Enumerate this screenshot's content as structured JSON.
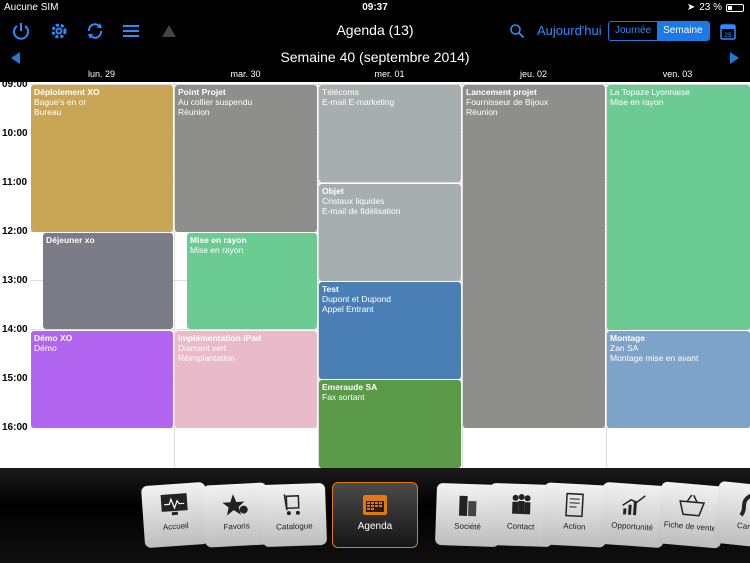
{
  "status": {
    "carrier": "Aucune SIM",
    "time": "09:37",
    "battery": "23 %"
  },
  "toolbar": {
    "title": "Agenda (13)",
    "today": "Aujourd'hui",
    "view_day": "Journée",
    "view_week": "Semaine",
    "calendar_day": "25"
  },
  "week": {
    "title": "Semaine 40 (septembre 2014)"
  },
  "days": [
    "lun. 29",
    "mar. 30",
    "mer. 01",
    "jeu. 02",
    "ven. 03"
  ],
  "hours": [
    "09:00",
    "10:00",
    "11:00",
    "12:00",
    "13:00",
    "14:00",
    "15:00",
    "16:00"
  ],
  "events": [
    {
      "title": "Déploiement XO",
      "lines": [
        "Bague's en or",
        "Bureau"
      ],
      "color": "#c8a655"
    },
    {
      "title": "Déjeuner xo",
      "lines": [],
      "color": "#7c7c86"
    },
    {
      "title": "Démo XO",
      "lines": [
        "Démo"
      ],
      "color": "#b265f0"
    },
    {
      "title": "Point Projet",
      "lines": [
        "Au collier suspendu",
        "Réunion"
      ],
      "color": "#8e8f8c"
    },
    {
      "title": "Mise en rayon",
      "lines": [
        "Mise en rayon"
      ],
      "color": "#6ccb92"
    },
    {
      "title": "Implémentation iPad",
      "lines": [
        "Diamant vert",
        "Réimplantation"
      ],
      "color": "#e9bac9"
    },
    {
      "title": "Télécoms",
      "lines": [
        "E-mail E-marketing"
      ],
      "color": "#a6aeaf",
      "title_bold": false
    },
    {
      "title": "Objet",
      "lines": [
        "Cristaux liquides",
        "E-mail de fidélisation"
      ],
      "color": "#a6aeaf"
    },
    {
      "title": "Test",
      "lines": [
        "Dupont et Dupond",
        "Appel Entrant"
      ],
      "color": "#4a7fb5"
    },
    {
      "title": "Emeraude SA",
      "lines": [
        "Fax sortant"
      ],
      "color": "#5a9a48"
    },
    {
      "title": "Lancement projet",
      "lines": [
        "Fournisseur de Bijoux",
        "Réunion"
      ],
      "color": "#8e8f8c"
    },
    {
      "title": "La Topaze Lyonnaise",
      "lines": [
        "Mise en rayon"
      ],
      "color": "#6ccb92",
      "title_bold": false
    },
    {
      "title": "Montage",
      "lines": [
        "Zan SA",
        "Montage mise en avant"
      ],
      "color": "#7ea3c8"
    }
  ],
  "dock": [
    {
      "label": "Accueil",
      "icon": "monitor-icon"
    },
    {
      "label": "Favoris",
      "icon": "star-icon"
    },
    {
      "label": "Catalogue",
      "icon": "cart-icon"
    },
    {
      "label": "Agenda",
      "icon": "calendar-icon",
      "active": true
    },
    {
      "label": "Société",
      "icon": "building-icon"
    },
    {
      "label": "Contact",
      "icon": "people-icon"
    },
    {
      "label": "Action",
      "icon": "document-icon"
    },
    {
      "label": "Opportunité",
      "icon": "chart-icon"
    },
    {
      "label": "Fiche de vente",
      "icon": "basket-icon"
    },
    {
      "label": "Carte",
      "icon": "road-icon"
    }
  ]
}
